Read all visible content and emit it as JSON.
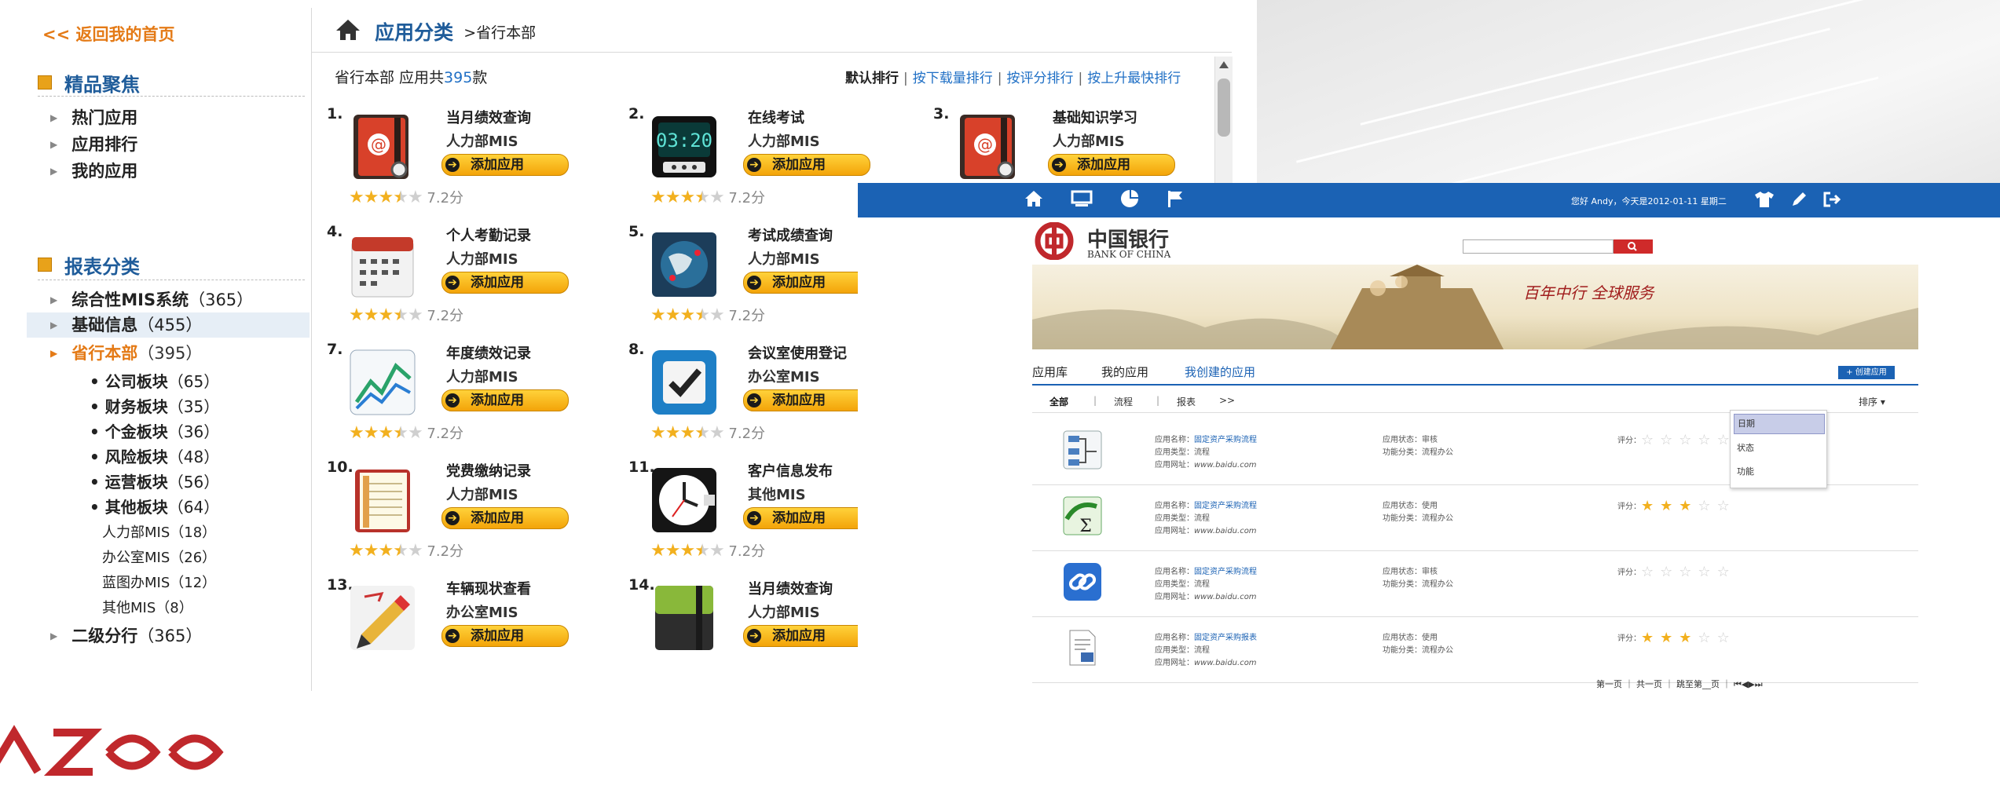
{
  "win1": {
    "sidebar": {
      "back_link": "<< 返回我的首页",
      "featured_title": "精品聚焦",
      "featured_items": [
        "热门应用",
        "应用排行",
        "我的应用"
      ],
      "report_title": "报表分类",
      "report_items": [
        {
          "label": "综合性MIS系统",
          "count": "（365）"
        },
        {
          "label": "基础信息",
          "count": "（455）"
        },
        {
          "label": "省行本部",
          "count": "（395）"
        }
      ],
      "sub_items": [
        {
          "label": "• 公司板块",
          "count": "（65）"
        },
        {
          "label": "• 财务板块",
          "count": "（35）"
        },
        {
          "label": "• 个金板块",
          "count": "（36）"
        },
        {
          "label": "• 风险板块",
          "count": "（48）"
        },
        {
          "label": "• 运营板块",
          "count": "（56）"
        },
        {
          "label": "• 其他板块",
          "count": "（64）"
        }
      ],
      "sub2_items": [
        {
          "label": "人力部MIS",
          "count": "（18）"
        },
        {
          "label": "办公室MIS",
          "count": "（26）"
        },
        {
          "label": "蓝图办MIS",
          "count": "（12）"
        },
        {
          "label": "其他MIS",
          "count": "（8）"
        }
      ],
      "last_item": {
        "label": "二级分行",
        "count": "（365）"
      }
    },
    "header": {
      "title": "应用分类",
      "crumb": ">省行本部"
    },
    "count": {
      "prefix": "省行本部 应用共",
      "num": "395",
      "suffix": "款"
    },
    "sort_options": [
      "默认排行",
      "按下载量排行",
      "按评分排行",
      "按上升最快排行"
    ],
    "add_label": "添加应用",
    "apps": [
      {
        "idx": "1.",
        "name": "当月绩效查询",
        "cat": "人力部MIS",
        "rating": 3.5,
        "score": "7.2分",
        "icon": "address-book-icon"
      },
      {
        "idx": "2.",
        "name": "在线考试",
        "cat": "人力部MIS",
        "rating": 3.5,
        "score": "7.2分",
        "icon": "clock-display-icon"
      },
      {
        "idx": "3.",
        "name": "基础知识学习",
        "cat": "人力部MIS",
        "rating": 3.5,
        "score": "7.2分",
        "icon": "address-book-icon"
      },
      {
        "idx": "4.",
        "name": "个人考勤记录",
        "cat": "人力部MIS",
        "rating": 3.5,
        "score": "7.2分",
        "icon": "calendar-icon"
      },
      {
        "idx": "5.",
        "name": "考试成绩查询",
        "cat": "人力部MIS",
        "rating": 3.5,
        "score": "7.2分",
        "icon": "globe-icon"
      },
      {
        "idx": "7.",
        "name": "年度绩效记录",
        "cat": "人力部MIS",
        "rating": 3.5,
        "score": "7.2分",
        "icon": "line-chart-icon"
      },
      {
        "idx": "8.",
        "name": "会议室使用登记",
        "cat": "办公室MIS",
        "rating": 3.5,
        "score": "7.2分",
        "icon": "checkbox-icon"
      },
      {
        "idx": "10.",
        "name": "党费缴纳记录",
        "cat": "人力部MIS",
        "rating": 3.5,
        "score": "7.2分",
        "icon": "notebook-icon"
      },
      {
        "idx": "11.",
        "name": "客户信息发布",
        "cat": "其他MIS",
        "rating": 3.5,
        "score": "7.2分",
        "icon": "wall-clock-icon"
      },
      {
        "idx": "13.",
        "name": "车辆现状查看",
        "cat": "办公室MIS",
        "rating": 0,
        "score": "",
        "icon": "pencil-icon"
      },
      {
        "idx": "14.",
        "name": "当月绩效查询",
        "cat": "人力部MIS",
        "rating": 0,
        "score": "",
        "icon": "green-book-icon"
      }
    ]
  },
  "win2": {
    "greeting": "您好 Andy，今天是2012-01-11 星期二",
    "bank_cn": "中国银行",
    "bank_en": "BANK OF CHINA",
    "banner_slogan": "百年中行 全球服务",
    "tabs": [
      "应用库",
      "我的应用",
      "我创建的应用"
    ],
    "create_button": "+ 创建应用",
    "filters": [
      "全部",
      "流程",
      "报表",
      ">>"
    ],
    "sort_label": "排序",
    "sort_menu": [
      "日期",
      "状态",
      "功能"
    ],
    "labels": {
      "name": "应用名称：",
      "type": "应用类型：",
      "url": "应用网址：",
      "status": "应用状态：",
      "func": "功能分类：",
      "score": "评分："
    },
    "rows": [
      {
        "name": "固定资产采购流程",
        "type": "流程",
        "url": "www.baidu.com",
        "status": "审核",
        "func": "流程办公",
        "stars": 0,
        "icon": "flowchart-icon"
      },
      {
        "name": "固定资产采购流程",
        "type": "流程",
        "url": "www.baidu.com",
        "status": "使用",
        "func": "流程办公",
        "stars": 3,
        "icon": "sigma-icon"
      },
      {
        "name": "固定资产采购流程",
        "type": "流程",
        "url": "www.baidu.com",
        "status": "审核",
        "func": "流程办公",
        "stars": 0,
        "icon": "link-icon"
      },
      {
        "name": "固定资产采购报表",
        "type": "流程",
        "url": "www.baidu.com",
        "status": "使用",
        "func": "流程办公",
        "stars": 3,
        "icon": "document-icon"
      }
    ],
    "pager": "第一页 ｜ 共一页 ｜ 跳至第__页 ｜ ⏮◀▶⏭"
  },
  "colors": {
    "accent_blue": "#1b62b4",
    "orange": "#e47a16",
    "star": "#f2b01e",
    "bank_red": "#c0282c"
  }
}
